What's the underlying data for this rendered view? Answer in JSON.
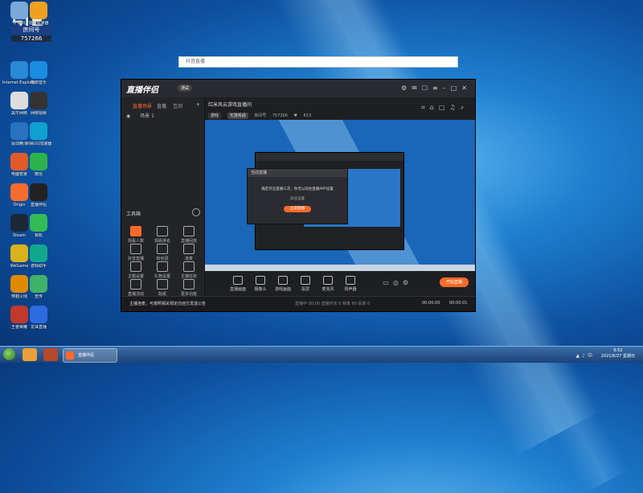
{
  "desktop": {
    "banner": {
      "big": "引E",
      "tag": "房间号",
      "number": "757266"
    },
    "icons": [
      {
        "label": "计算机",
        "color": "#7aa8d8"
      },
      {
        "label": "雷神加速器",
        "color": "#f0a020"
      },
      {
        "label": "Internet Explorer",
        "color": "#2a8ad8"
      },
      {
        "label": "酷狗音乐",
        "color": "#1a8de0"
      },
      {
        "label": "黑牛网络",
        "color": "#dddddd"
      },
      {
        "label": "网络视频",
        "color": "#333333"
      },
      {
        "label": "驱动精灵",
        "color": "#2a72c0"
      },
      {
        "label": "网易UU加速器",
        "color": "#0fa0d0"
      },
      {
        "label": "电脑管家",
        "color": "#e05a2a"
      },
      {
        "label": "微信",
        "color": "#2bb24c"
      },
      {
        "label": "Origin",
        "color": "#f56c2d"
      },
      {
        "label": "直播伴侣",
        "color": "#222222"
      },
      {
        "label": "Steam",
        "color": "#1b2838"
      },
      {
        "label": "锁机",
        "color": "#33bb55"
      },
      {
        "label": "WeGame",
        "color": "#d9b21c"
      },
      {
        "label": "游戏助手",
        "color": "#11a88e"
      },
      {
        "label": "穿越火线",
        "color": "#e08a00"
      },
      {
        "label": "宣传",
        "color": "#3fb26a"
      },
      {
        "label": "王者荣耀",
        "color": "#c0392b"
      },
      {
        "label": "龙珠直播",
        "color": "#2d6be0"
      }
    ]
  },
  "white_window": {
    "title": "抖音直播"
  },
  "app": {
    "logo": "直播伴侣",
    "logo_badge": "测试",
    "left_tabs": [
      "直播场景",
      "直播",
      "互动"
    ],
    "scene": "场景 1",
    "toolbox_title": "工具箱",
    "tools": [
      {
        "label": "观看人数",
        "hot": true
      },
      {
        "label": "观看排名"
      },
      {
        "label": "直播回放"
      },
      {
        "label": "抖音直播"
      },
      {
        "label": "粉丝团"
      },
      {
        "label": "连麦"
      },
      {
        "label": "主题设置"
      },
      {
        "label": "礼物设置"
      },
      {
        "label": "主播任务"
      },
      {
        "label": "直播活动"
      },
      {
        "label": "贴纸"
      },
      {
        "label": "更多功能"
      }
    ],
    "room": {
      "title": "红米风云游戏直播间",
      "category": "游戏",
      "tag": "无游戏战",
      "id_label": "房间号",
      "id": "757266",
      "fans": "813"
    },
    "dialog": {
      "title": "当前直播",
      "message": "确定开启直播三次，你可以前往直播APP设置",
      "link": "前往设置",
      "button": "立即直播"
    },
    "bottom_tools": [
      "直播画面",
      "摄像头",
      "游戏画面",
      "投屏",
      "麦克风",
      "扬声器"
    ],
    "start_live": "开始直播",
    "notice": "主播连麦，可按照相关规定向他方发送公告",
    "status": "直播中 00:00  直播时长 0  帧率 60  码率 0",
    "time_left": "00:00:00",
    "time_right": "00:00:01"
  },
  "taskbar": {
    "active_label": "直播伴侣",
    "clock_time": "9:52",
    "clock_date": "2021/6/27 星期日"
  }
}
